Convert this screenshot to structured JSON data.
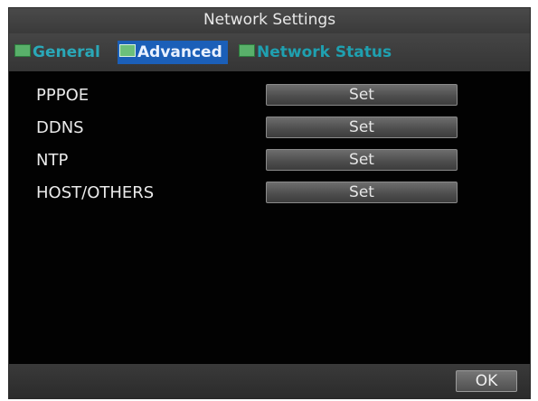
{
  "window": {
    "title": "Network Settings"
  },
  "tabs": [
    {
      "label": "General",
      "icon": "tab-icon"
    },
    {
      "label": "Advanced",
      "icon": "tab-icon",
      "active": true
    },
    {
      "label": "Network Status",
      "icon": "tab-icon"
    }
  ],
  "rows": [
    {
      "label": "PPPOE",
      "button": "Set"
    },
    {
      "label": "DDNS",
      "button": "Set"
    },
    {
      "label": "NTP",
      "button": "Set"
    },
    {
      "label": "HOST/OTHERS",
      "button": "Set"
    }
  ],
  "footer": {
    "ok_label": "OK"
  },
  "colors": {
    "active_tab": "#1b5fb8",
    "tab_text": "#2aa8b8",
    "background": "#040404"
  }
}
